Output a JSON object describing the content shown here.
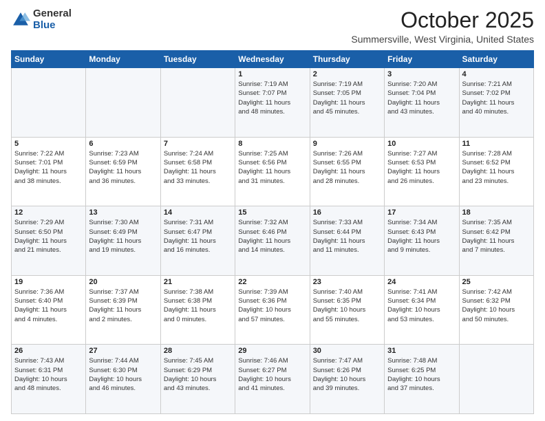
{
  "logo": {
    "general": "General",
    "blue": "Blue"
  },
  "header": {
    "title": "October 2025",
    "subtitle": "Summersville, West Virginia, United States"
  },
  "weekdays": [
    "Sunday",
    "Monday",
    "Tuesday",
    "Wednesday",
    "Thursday",
    "Friday",
    "Saturday"
  ],
  "weeks": [
    [
      {
        "day": "",
        "info": ""
      },
      {
        "day": "",
        "info": ""
      },
      {
        "day": "",
        "info": ""
      },
      {
        "day": "1",
        "info": "Sunrise: 7:19 AM\nSunset: 7:07 PM\nDaylight: 11 hours\nand 48 minutes."
      },
      {
        "day": "2",
        "info": "Sunrise: 7:19 AM\nSunset: 7:05 PM\nDaylight: 11 hours\nand 45 minutes."
      },
      {
        "day": "3",
        "info": "Sunrise: 7:20 AM\nSunset: 7:04 PM\nDaylight: 11 hours\nand 43 minutes."
      },
      {
        "day": "4",
        "info": "Sunrise: 7:21 AM\nSunset: 7:02 PM\nDaylight: 11 hours\nand 40 minutes."
      }
    ],
    [
      {
        "day": "5",
        "info": "Sunrise: 7:22 AM\nSunset: 7:01 PM\nDaylight: 11 hours\nand 38 minutes."
      },
      {
        "day": "6",
        "info": "Sunrise: 7:23 AM\nSunset: 6:59 PM\nDaylight: 11 hours\nand 36 minutes."
      },
      {
        "day": "7",
        "info": "Sunrise: 7:24 AM\nSunset: 6:58 PM\nDaylight: 11 hours\nand 33 minutes."
      },
      {
        "day": "8",
        "info": "Sunrise: 7:25 AM\nSunset: 6:56 PM\nDaylight: 11 hours\nand 31 minutes."
      },
      {
        "day": "9",
        "info": "Sunrise: 7:26 AM\nSunset: 6:55 PM\nDaylight: 11 hours\nand 28 minutes."
      },
      {
        "day": "10",
        "info": "Sunrise: 7:27 AM\nSunset: 6:53 PM\nDaylight: 11 hours\nand 26 minutes."
      },
      {
        "day": "11",
        "info": "Sunrise: 7:28 AM\nSunset: 6:52 PM\nDaylight: 11 hours\nand 23 minutes."
      }
    ],
    [
      {
        "day": "12",
        "info": "Sunrise: 7:29 AM\nSunset: 6:50 PM\nDaylight: 11 hours\nand 21 minutes."
      },
      {
        "day": "13",
        "info": "Sunrise: 7:30 AM\nSunset: 6:49 PM\nDaylight: 11 hours\nand 19 minutes."
      },
      {
        "day": "14",
        "info": "Sunrise: 7:31 AM\nSunset: 6:47 PM\nDaylight: 11 hours\nand 16 minutes."
      },
      {
        "day": "15",
        "info": "Sunrise: 7:32 AM\nSunset: 6:46 PM\nDaylight: 11 hours\nand 14 minutes."
      },
      {
        "day": "16",
        "info": "Sunrise: 7:33 AM\nSunset: 6:44 PM\nDaylight: 11 hours\nand 11 minutes."
      },
      {
        "day": "17",
        "info": "Sunrise: 7:34 AM\nSunset: 6:43 PM\nDaylight: 11 hours\nand 9 minutes."
      },
      {
        "day": "18",
        "info": "Sunrise: 7:35 AM\nSunset: 6:42 PM\nDaylight: 11 hours\nand 7 minutes."
      }
    ],
    [
      {
        "day": "19",
        "info": "Sunrise: 7:36 AM\nSunset: 6:40 PM\nDaylight: 11 hours\nand 4 minutes."
      },
      {
        "day": "20",
        "info": "Sunrise: 7:37 AM\nSunset: 6:39 PM\nDaylight: 11 hours\nand 2 minutes."
      },
      {
        "day": "21",
        "info": "Sunrise: 7:38 AM\nSunset: 6:38 PM\nDaylight: 11 hours\nand 0 minutes."
      },
      {
        "day": "22",
        "info": "Sunrise: 7:39 AM\nSunset: 6:36 PM\nDaylight: 10 hours\nand 57 minutes."
      },
      {
        "day": "23",
        "info": "Sunrise: 7:40 AM\nSunset: 6:35 PM\nDaylight: 10 hours\nand 55 minutes."
      },
      {
        "day": "24",
        "info": "Sunrise: 7:41 AM\nSunset: 6:34 PM\nDaylight: 10 hours\nand 53 minutes."
      },
      {
        "day": "25",
        "info": "Sunrise: 7:42 AM\nSunset: 6:32 PM\nDaylight: 10 hours\nand 50 minutes."
      }
    ],
    [
      {
        "day": "26",
        "info": "Sunrise: 7:43 AM\nSunset: 6:31 PM\nDaylight: 10 hours\nand 48 minutes."
      },
      {
        "day": "27",
        "info": "Sunrise: 7:44 AM\nSunset: 6:30 PM\nDaylight: 10 hours\nand 46 minutes."
      },
      {
        "day": "28",
        "info": "Sunrise: 7:45 AM\nSunset: 6:29 PM\nDaylight: 10 hours\nand 43 minutes."
      },
      {
        "day": "29",
        "info": "Sunrise: 7:46 AM\nSunset: 6:27 PM\nDaylight: 10 hours\nand 41 minutes."
      },
      {
        "day": "30",
        "info": "Sunrise: 7:47 AM\nSunset: 6:26 PM\nDaylight: 10 hours\nand 39 minutes."
      },
      {
        "day": "31",
        "info": "Sunrise: 7:48 AM\nSunset: 6:25 PM\nDaylight: 10 hours\nand 37 minutes."
      },
      {
        "day": "",
        "info": ""
      }
    ]
  ]
}
